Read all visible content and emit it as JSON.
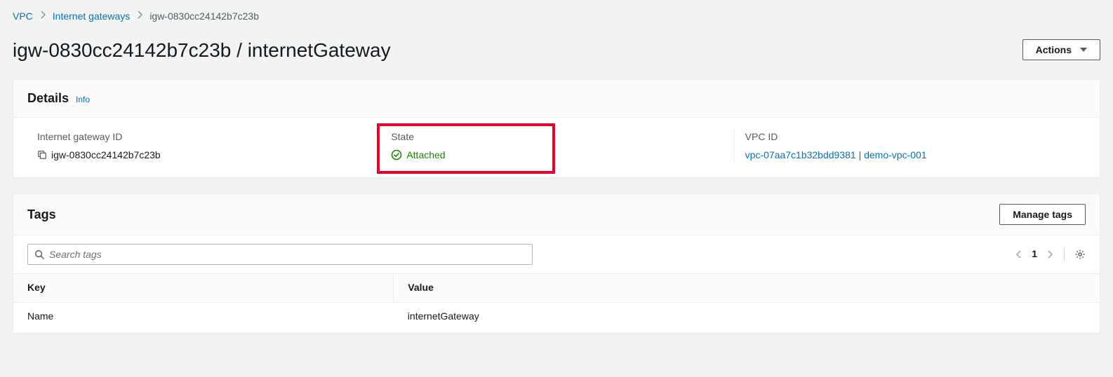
{
  "breadcrumbs": {
    "root": "VPC",
    "parent": "Internet gateways",
    "current": "igw-0830cc24142b7c23b"
  },
  "page_title": "igw-0830cc24142b7c23b / internetGateway",
  "actions_button": "Actions",
  "details": {
    "heading": "Details",
    "info": "Info",
    "igw_id_label": "Internet gateway ID",
    "igw_id_value": "igw-0830cc24142b7c23b",
    "state_label": "State",
    "state_value": "Attached",
    "vpc_id_label": "VPC ID",
    "vpc_id_value": "vpc-07aa7c1b32bdd9381 | demo-vpc-001"
  },
  "tags": {
    "heading": "Tags",
    "manage_button": "Manage tags",
    "search_placeholder": "Search tags",
    "page_number": "1",
    "columns": {
      "key": "Key",
      "value": "Value"
    },
    "rows": [
      {
        "key": "Name",
        "value": "internetGateway"
      }
    ]
  }
}
